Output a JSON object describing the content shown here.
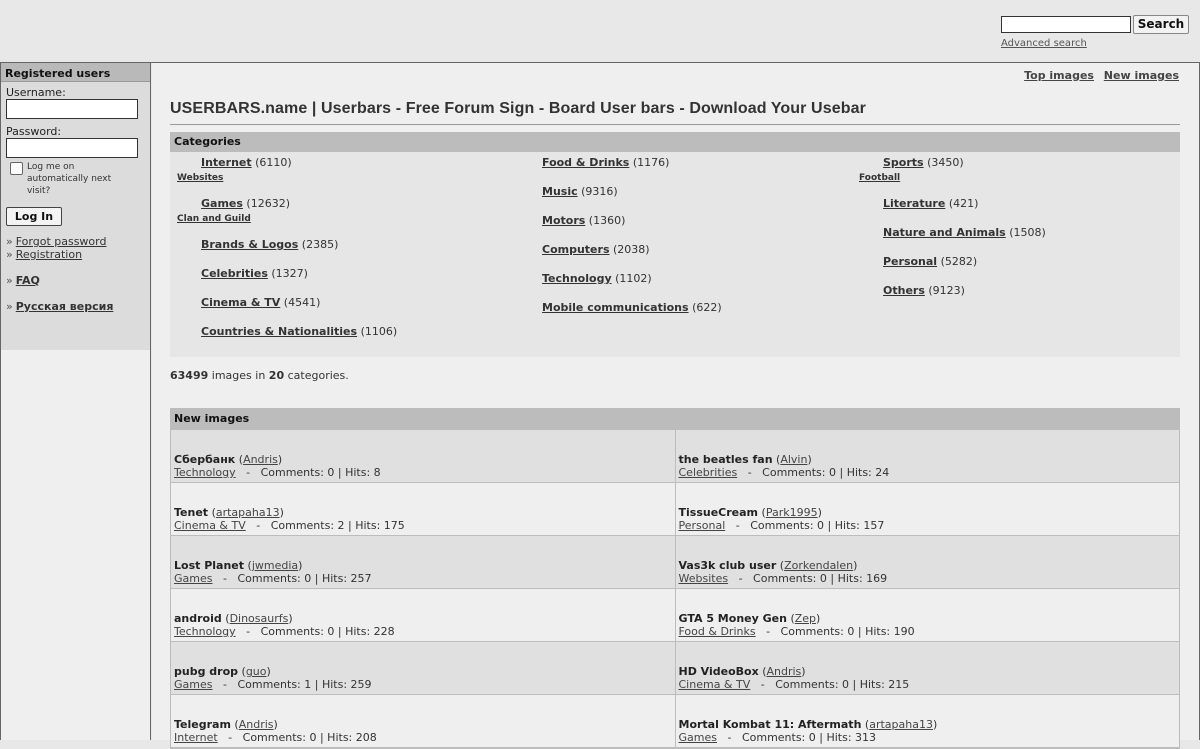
{
  "header": {
    "search_placeholder": "",
    "search_button": "Search",
    "advanced_search": "Advanced search"
  },
  "sidebar": {
    "title": "Registered users",
    "username_label": "Username:",
    "password_label": "Password:",
    "remember_label": "Log me on automatically next visit?",
    "login_button": "Log In",
    "links": {
      "forgot": "Forgot password",
      "registration": "Registration",
      "faq": "FAQ",
      "russian": "Русская версия"
    },
    "bullet": "»"
  },
  "toplinks": {
    "top": "Top images",
    "new": "New images"
  },
  "page_title": "USERBARS.name | Userbars - Free Forum Sign - Board User bars - Download Your Usebar",
  "categories": {
    "heading": "Categories",
    "columns": [
      [
        {
          "name": "Internet",
          "count": "(6110)",
          "sub": "Websites"
        },
        {
          "name": "Games",
          "count": "(12632)",
          "sub": "Clan and Guild"
        },
        {
          "name": "Brands & Logos",
          "count": "(2385)"
        },
        {
          "name": "Celebrities",
          "count": "(1327)"
        },
        {
          "name": "Cinema & TV",
          "count": "(4541)"
        },
        {
          "name": "Countries & Nationalities",
          "count": "(1106)"
        }
      ],
      [
        {
          "name": "Food & Drinks",
          "count": "(1176)"
        },
        {
          "name": "Music",
          "count": "(9316)"
        },
        {
          "name": "Motors",
          "count": "(1360)"
        },
        {
          "name": "Computers",
          "count": "(2038)"
        },
        {
          "name": "Technology",
          "count": "(1102)"
        },
        {
          "name": "Mobile communications",
          "count": "(622)"
        }
      ],
      [
        {
          "name": "Sports",
          "count": "(3450)",
          "sub": "Football"
        },
        {
          "name": "Literature",
          "count": "(421)"
        },
        {
          "name": "Nature and Animals",
          "count": "(1508)"
        },
        {
          "name": "Personal",
          "count": "(5282)"
        },
        {
          "name": "Others",
          "count": "(9123)"
        }
      ]
    ]
  },
  "stats": {
    "images": "63499",
    "text1": " images in ",
    "categories": "20",
    "text2": " categories."
  },
  "new_images": {
    "heading": "New images",
    "rows": [
      [
        {
          "title": "Сбербанк",
          "author": "Andris",
          "category": "Technology",
          "comments": "Comments: 0",
          "hits": "Hits: 8"
        },
        {
          "title": "the beatles fan",
          "author": "Alvin",
          "category": "Celebrities",
          "comments": "Comments: 0",
          "hits": "Hits: 24"
        }
      ],
      [
        {
          "title": "Tenet",
          "author": "artapaha13",
          "category": "Cinema & TV",
          "comments": "Comments: 2",
          "hits": "Hits: 175"
        },
        {
          "title": "TissueCream",
          "author": "Park1995",
          "category": "Personal",
          "comments": "Comments: 0",
          "hits": "Hits: 157"
        }
      ],
      [
        {
          "title": "Lost Planet",
          "author": "jwmedia",
          "category": "Games",
          "comments": "Comments: 0",
          "hits": "Hits: 257"
        },
        {
          "title": "Vas3k club user",
          "author": "Zorkendalen",
          "category": "Websites",
          "comments": "Comments: 0",
          "hits": "Hits: 169"
        }
      ],
      [
        {
          "title": "android",
          "author": "Dinosaurfs",
          "category": "Technology",
          "comments": "Comments: 0",
          "hits": "Hits: 228"
        },
        {
          "title": "GTA 5 Money Gen",
          "author": "Zep",
          "category": "Food & Drinks",
          "comments": "Comments: 0",
          "hits": "Hits: 190"
        }
      ],
      [
        {
          "title": "pubg drop",
          "author": "guo",
          "category": "Games",
          "comments": "Comments: 1",
          "hits": "Hits: 259"
        },
        {
          "title": "HD VideoBox",
          "author": "Andris",
          "category": "Cinema & TV",
          "comments": "Comments: 0",
          "hits": "Hits: 215"
        }
      ],
      [
        {
          "title": "Telegram",
          "author": "Andris",
          "category": "Internet",
          "comments": "Comments: 0",
          "hits": "Hits: 208"
        },
        {
          "title": "Mortal Kombat 11: Aftermath",
          "author": "artapaha13",
          "category": "Games",
          "comments": "Comments: 0",
          "hits": "Hits: 313"
        }
      ]
    ]
  }
}
